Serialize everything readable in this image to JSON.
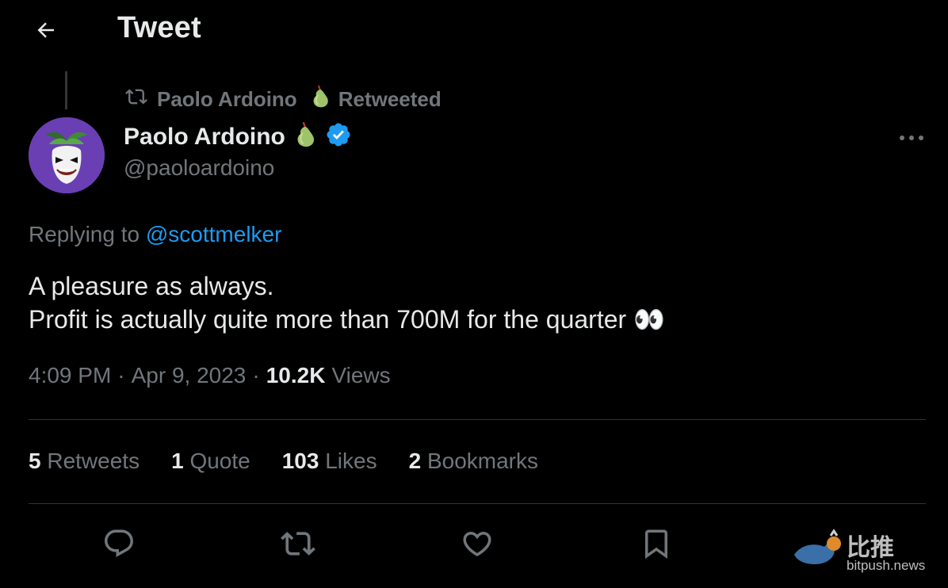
{
  "header": {
    "title": "Tweet"
  },
  "retweet": {
    "user": "Paolo Ardoino",
    "action": "Retweeted"
  },
  "author": {
    "name": "Paolo Ardoino",
    "handle": "@paoloardoino"
  },
  "replying": {
    "prefix": "Replying to",
    "mention": "@scottmelker"
  },
  "tweet": {
    "text": "A pleasure as always.\nProfit is actually quite more than 700M for the quarter 👀"
  },
  "meta": {
    "time": "4:09 PM",
    "date": "Apr 9, 2023",
    "sep": "·",
    "views_count": "10.2K",
    "views_label": "Views"
  },
  "stats": [
    {
      "count": "5",
      "label": "Retweets"
    },
    {
      "count": "1",
      "label": "Quote"
    },
    {
      "count": "103",
      "label": "Likes"
    },
    {
      "count": "2",
      "label": "Bookmarks"
    }
  ],
  "actions": [
    "reply-icon",
    "retweet-icon",
    "like-icon",
    "bookmark-icon"
  ],
  "watermark": {
    "cn": "比推",
    "url": "bitpush.news"
  },
  "colors": {
    "accent": "#1d9bf0",
    "muted": "#71767b",
    "text": "#e7e9ea",
    "bg": "#000000",
    "verified": "#1d9bf0",
    "avatar_bg": "#6a3fb3",
    "pear": "#9fc36b"
  }
}
